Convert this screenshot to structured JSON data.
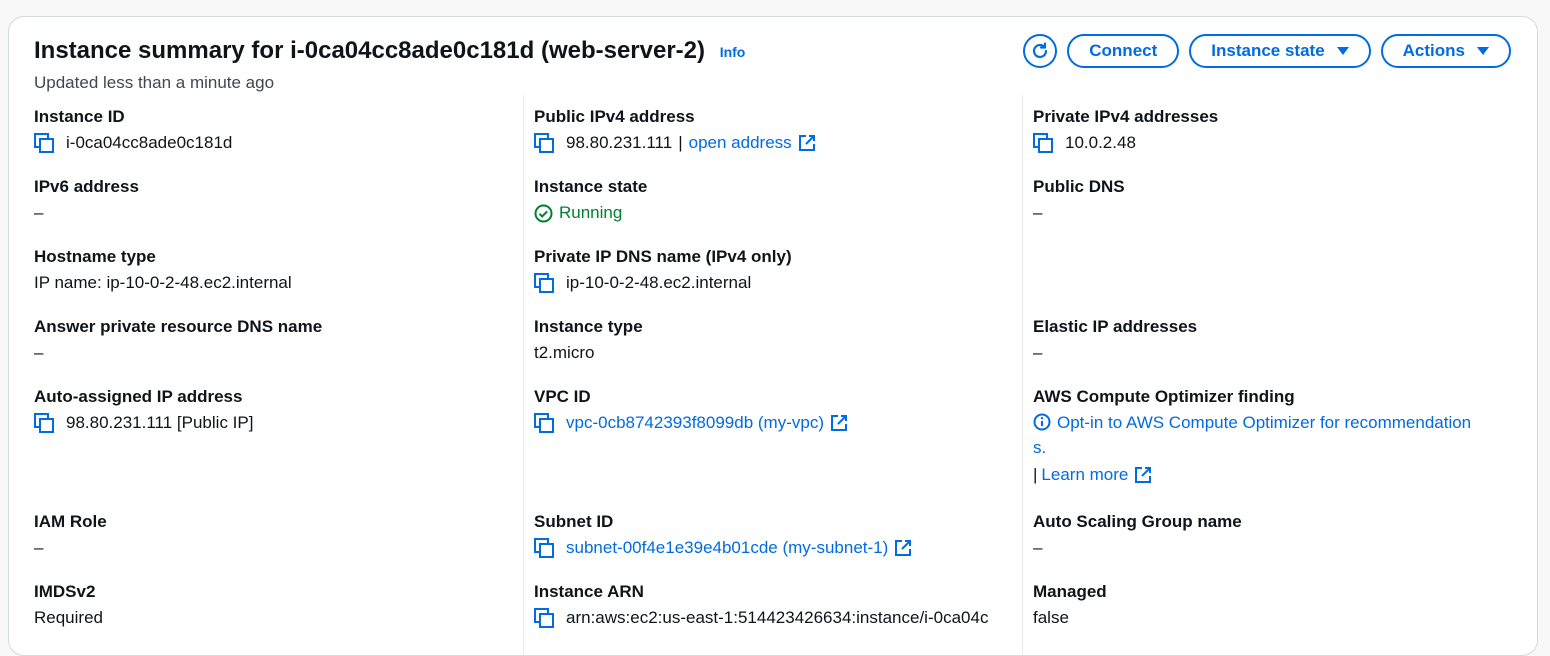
{
  "header": {
    "title": "Instance summary for i-0ca04cc8ade0c181d (web-server-2)",
    "info_label": "Info",
    "subtitle": "Updated less than a minute ago",
    "connect_label": "Connect",
    "instance_state_label": "Instance state",
    "actions_label": "Actions"
  },
  "col1": {
    "instance_id": {
      "label": "Instance ID",
      "value": "i-0ca04cc8ade0c181d"
    },
    "ipv6": {
      "label": "IPv6 address",
      "value": "–"
    },
    "hostname_type": {
      "label": "Hostname type",
      "value": "IP name: ip-10-0-2-48.ec2.internal"
    },
    "answer_dns": {
      "label": "Answer private resource DNS name",
      "value": "–"
    },
    "auto_ip": {
      "label": "Auto-assigned IP address",
      "value": "98.80.231.111 [Public IP]"
    },
    "iam_role": {
      "label": "IAM Role",
      "value": "–"
    },
    "imdsv2": {
      "label": "IMDSv2",
      "value": "Required"
    }
  },
  "col2": {
    "public_ipv4": {
      "label": "Public IPv4 address",
      "value": "98.80.231.111",
      "separator": "|",
      "link": "open address"
    },
    "instance_state": {
      "label": "Instance state",
      "value": "Running"
    },
    "private_dns": {
      "label": "Private IP DNS name (IPv4 only)",
      "value": "ip-10-0-2-48.ec2.internal"
    },
    "instance_type": {
      "label": "Instance type",
      "value": "t2.micro"
    },
    "vpc_id": {
      "label": "VPC ID",
      "value": "vpc-0cb8742393f8099db (my-vpc)"
    },
    "subnet_id": {
      "label": "Subnet ID",
      "value": "subnet-00f4e1e39e4b01cde (my-subnet-1)"
    },
    "instance_arn": {
      "label": "Instance ARN",
      "value": "arn:aws:ec2:us-east-1:514423426634:instance/i-0ca04c"
    }
  },
  "col3": {
    "private_ipv4": {
      "label": "Private IPv4 addresses",
      "value": "10.0.2.48"
    },
    "public_dns": {
      "label": "Public DNS",
      "value": "–"
    },
    "elastic_ip": {
      "label": "Elastic IP addresses",
      "value": "–"
    },
    "optimizer": {
      "label": "AWS Compute Optimizer finding",
      "value": "Opt-in to AWS Compute Optimizer for recommendation",
      "value_tail": "s.",
      "separator": "|",
      "learn_more": "Learn more"
    },
    "asg": {
      "label": "Auto Scaling Group name",
      "value": "–"
    },
    "managed": {
      "label": "Managed",
      "value": "false"
    }
  },
  "colors": {
    "link": "#006ce0",
    "running": "#00802f",
    "text": "#0f141a",
    "muted": "#424650"
  },
  "icons": [
    "refresh-icon",
    "copy-icon",
    "external-link-icon",
    "check-circle-icon",
    "info-circle-icon",
    "caret-down-icon"
  ]
}
